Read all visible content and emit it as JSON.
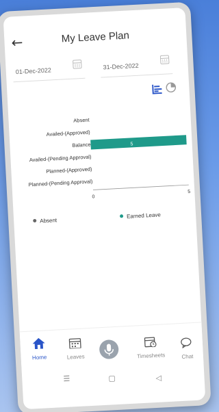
{
  "header": {
    "back_icon": "back-arrow-icon",
    "title": "My Leave Plan"
  },
  "filters": {
    "from_date": "01-Dec-2022",
    "to_date": "31-Dec-2022",
    "calendar_icon": "calendar-icon"
  },
  "view_toggle": {
    "bar_icon": "bar-chart-icon",
    "pie_icon": "pie-chart-icon",
    "active_color": "#2a55c8"
  },
  "chart_data": {
    "type": "bar",
    "orientation": "horizontal",
    "categories": [
      "Absent",
      "Availed-(Approved)",
      "Balance",
      "Availed-(Pending Approval)",
      "Planned-(Approved)",
      "Planned-(Pending Approval)"
    ],
    "series": [
      {
        "name": "Absent",
        "color": "#666666",
        "values": [
          0,
          0,
          0,
          0,
          0,
          0
        ]
      },
      {
        "name": "Earned Leave",
        "color": "#1f9a8a",
        "values": [
          0,
          0,
          5,
          0,
          0,
          0
        ]
      }
    ],
    "data_labels": [
      "",
      "",
      "5",
      "",
      "",
      ""
    ],
    "xlim": [
      0,
      5
    ],
    "x_ticks": [
      "0",
      "5"
    ],
    "legend_position": "bottom"
  },
  "bottom_nav": {
    "items": [
      {
        "label": "Home",
        "icon": "home-icon"
      },
      {
        "label": "Leaves",
        "icon": "leaves-calendar-icon"
      },
      {
        "label": "",
        "icon": "mic-icon"
      },
      {
        "label": "Timesheets",
        "icon": "timesheets-icon"
      },
      {
        "label": "Chat",
        "icon": "chat-icon"
      }
    ],
    "active_color": "#2a55c8"
  },
  "system_nav": {
    "menu_icon": "menu-lines-icon",
    "home_icon": "square-home-icon",
    "back_icon": "triangle-back-icon"
  }
}
